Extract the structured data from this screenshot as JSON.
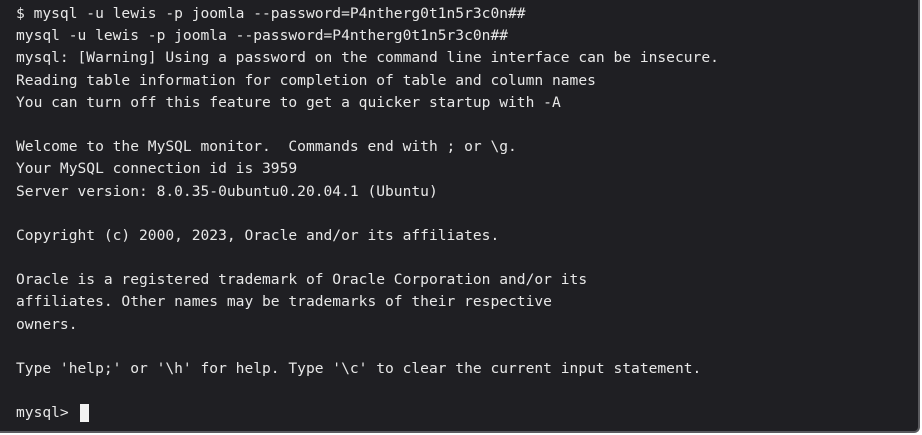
{
  "terminal": {
    "lines": [
      "$ mysql -u lewis -p joomla --password=P4ntherg0t1n5r3c0n##",
      "mysql -u lewis -p joomla --password=P4ntherg0t1n5r3c0n##",
      "mysql: [Warning] Using a password on the command line interface can be insecure.",
      "Reading table information for completion of table and column names",
      "You can turn off this feature to get a quicker startup with -A",
      "",
      "Welcome to the MySQL monitor.  Commands end with ; or \\g.",
      "Your MySQL connection id is 3959",
      "Server version: 8.0.35-0ubuntu0.20.04.1 (Ubuntu)",
      "",
      "Copyright (c) 2000, 2023, Oracle and/or its affiliates.",
      "",
      "Oracle is a registered trademark of Oracle Corporation and/or its",
      "affiliates. Other names may be trademarks of their respective",
      "owners.",
      "",
      "Type 'help;' or '\\h' for help. Type '\\c' to clear the current input statement.",
      ""
    ],
    "prompt": "mysql> "
  },
  "colors": {
    "background": "#1f1f23",
    "text": "#e8e8e8",
    "cursor": "#f2f2f2"
  }
}
